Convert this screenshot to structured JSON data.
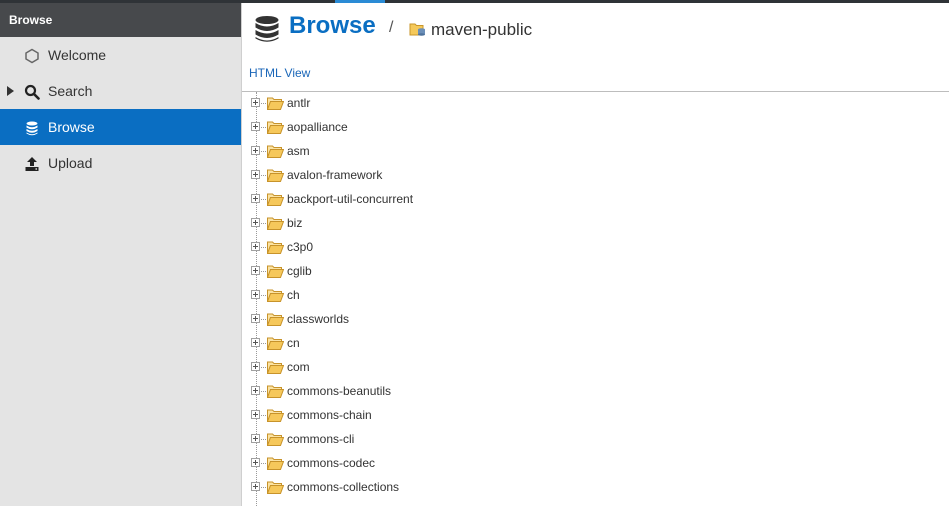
{
  "sidebar": {
    "header": "Browse",
    "items": [
      {
        "label": "Welcome",
        "icon": "hexagon-icon"
      },
      {
        "label": "Search",
        "icon": "search-icon"
      },
      {
        "label": "Browse",
        "icon": "database-icon",
        "selected": true
      },
      {
        "label": "Upload",
        "icon": "upload-icon"
      }
    ]
  },
  "breadcrumb": {
    "title": "Browse",
    "separator": "/",
    "repository": "maven-public"
  },
  "html_view_link": "HTML View",
  "tree": {
    "items": [
      "antlr",
      "aopalliance",
      "asm",
      "avalon-framework",
      "backport-util-concurrent",
      "biz",
      "c3p0",
      "cglib",
      "ch",
      "classworlds",
      "cn",
      "com",
      "commons-beanutils",
      "commons-chain",
      "commons-cli",
      "commons-codec",
      "commons-collections"
    ]
  },
  "colors": {
    "accent": "#0a6ec2",
    "link": "#1a66b8",
    "sidebar_bg": "#e4e4e4",
    "sidebar_header_bg": "#47494c",
    "folder": "#f0b429"
  }
}
